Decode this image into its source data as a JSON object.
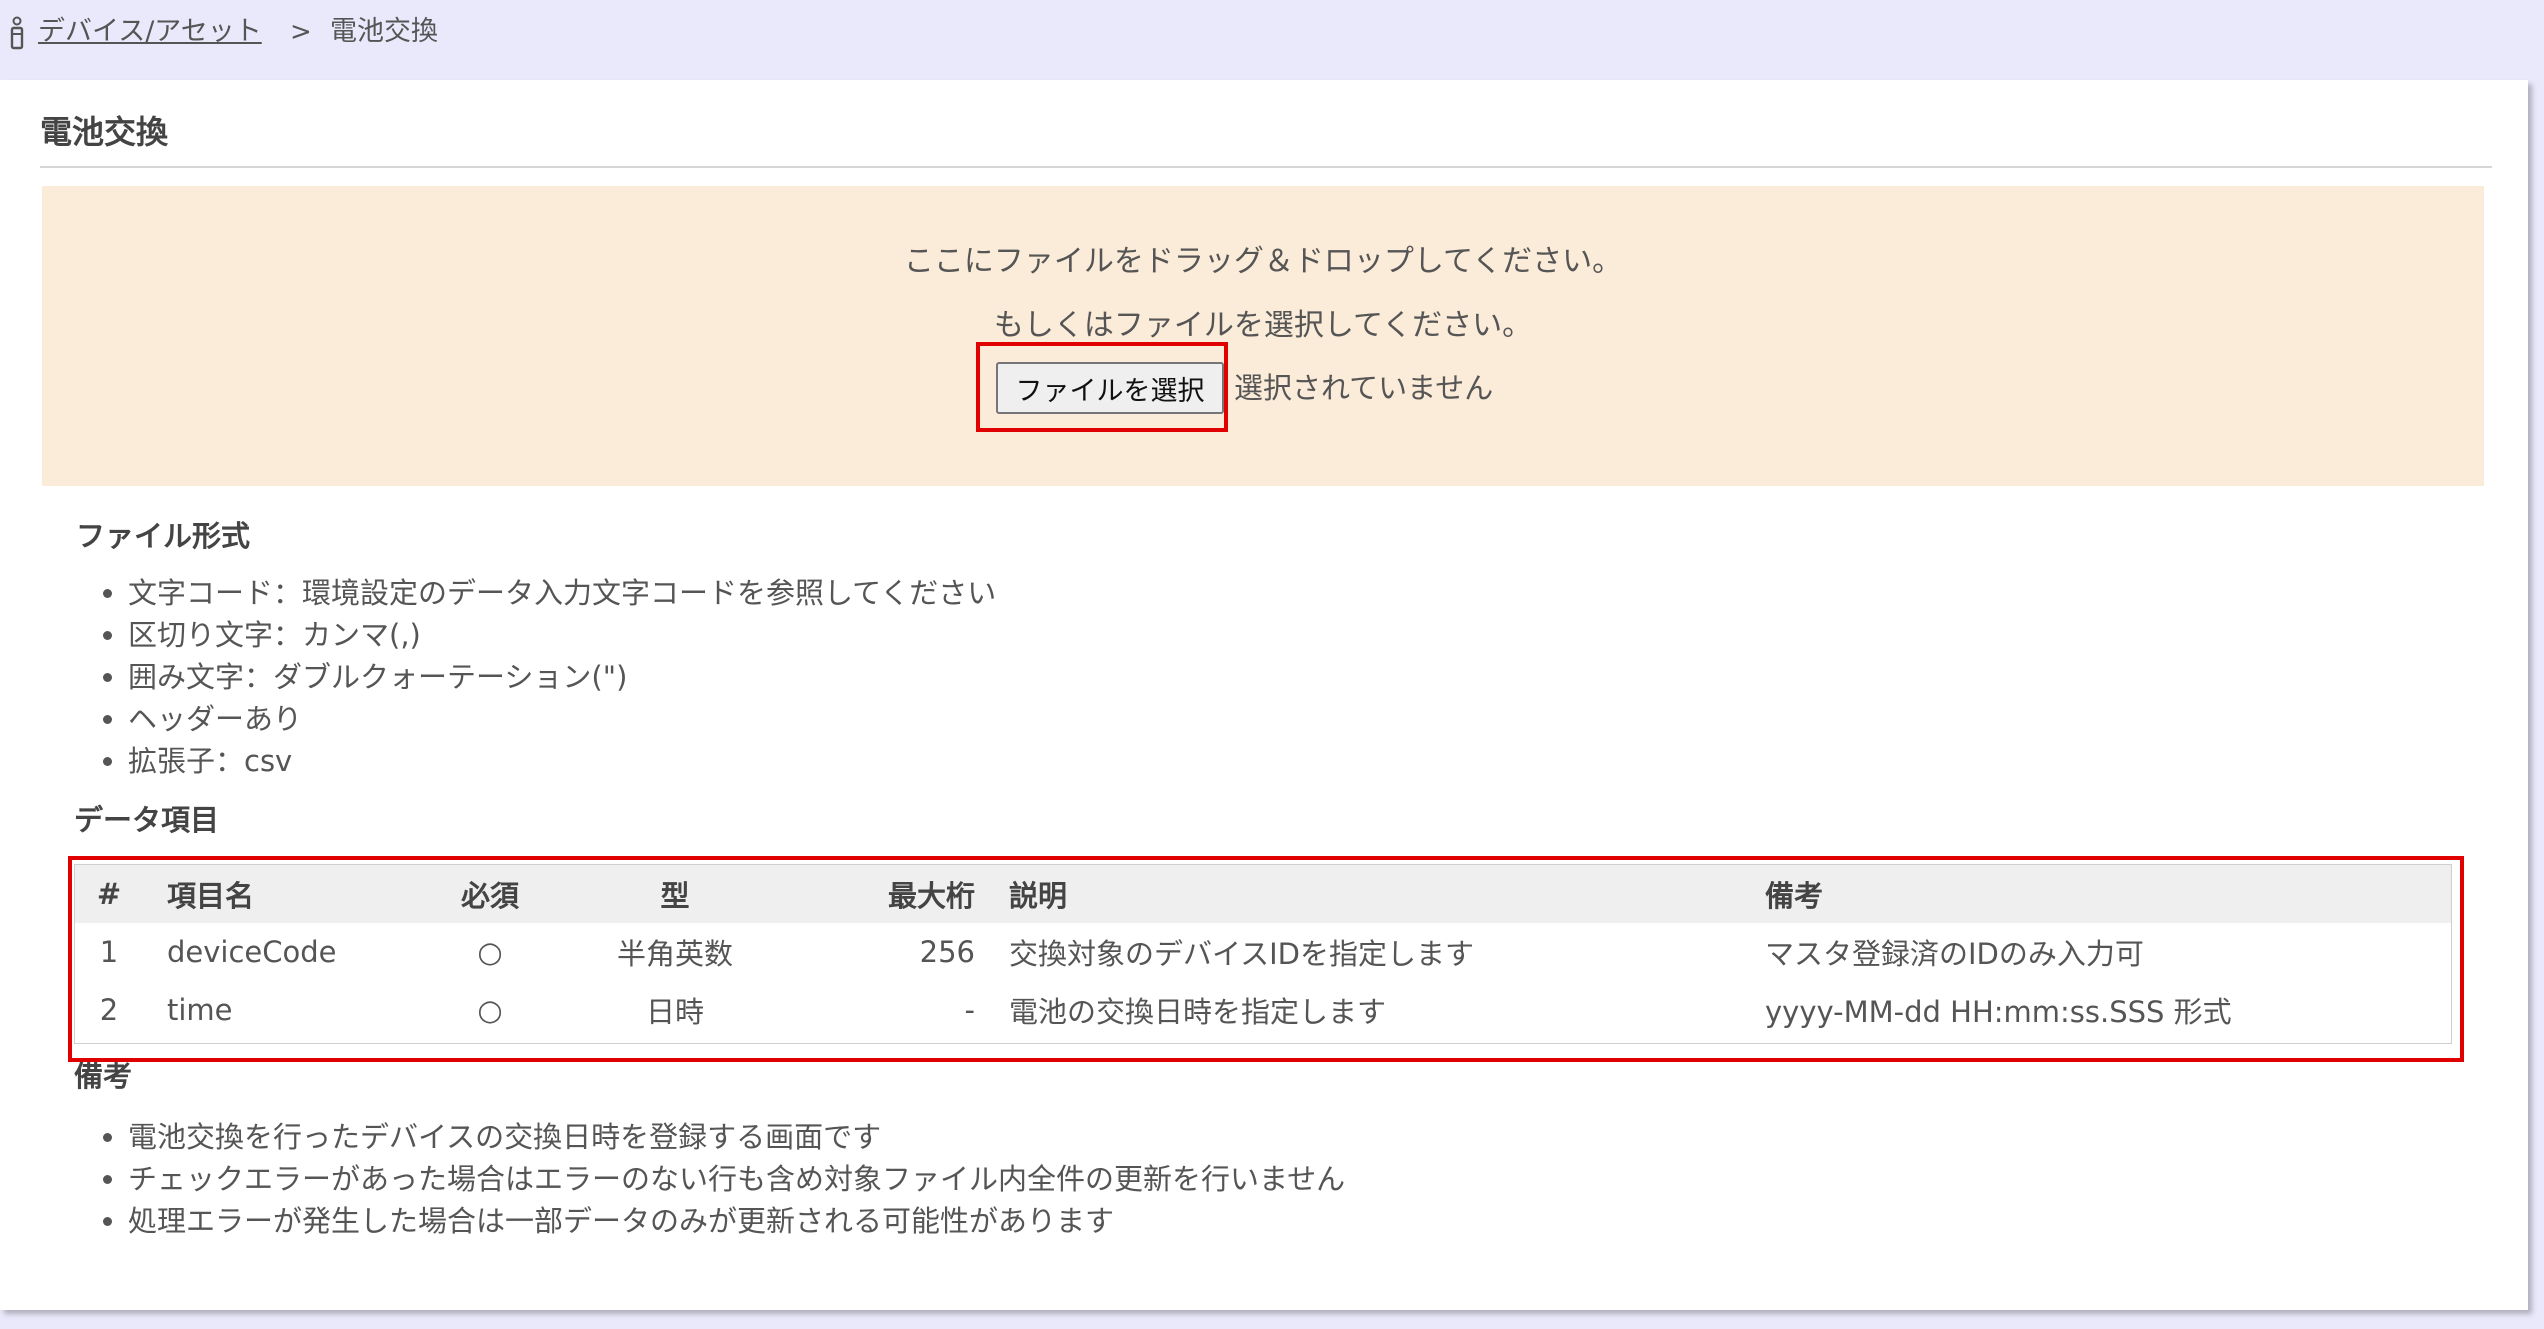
{
  "breadcrumb": {
    "parent_label": "デバイス/アセット",
    "separator": ">",
    "current_label": "電池交換"
  },
  "page": {
    "title": "電池交換"
  },
  "dropzone": {
    "line1": "ここにファイルをドラッグ＆ドロップしてください。",
    "line2": "もしくはファイルを選択してください。",
    "button_label": "ファイルを選択",
    "status_text": "選択されていません"
  },
  "file_format": {
    "heading": "ファイル形式",
    "items": [
      "文字コード：環境設定のデータ入力文字コードを参照してください",
      "区切り文字：カンマ(,)",
      "囲み文字：ダブルクォーテーション(\")",
      "ヘッダーあり",
      "拡張子：csv"
    ]
  },
  "data_items": {
    "heading": "データ項目",
    "columns": [
      "#",
      "項目名",
      "必須",
      "型",
      "最大桁",
      "説明",
      "備考"
    ],
    "rows": [
      [
        "1",
        "deviceCode",
        "○",
        "半角英数",
        "256",
        "交換対象のデバイスIDを指定します",
        "マスタ登録済のIDのみ入力可"
      ],
      [
        "2",
        "time",
        "○",
        "日時",
        "-",
        "電池の交換日時を指定します",
        "yyyy-MM-dd HH:mm:ss.SSS 形式"
      ]
    ]
  },
  "remarks": {
    "heading": "備考",
    "items": [
      "電池交換を行ったデバイスの交換日時を登録する画面です",
      "チェックエラーがあった場合はエラーのない行も含め対象ファイル内全件の更新を行いません",
      "処理エラーが発生した場合は一部データのみが更新される可能性があります"
    ]
  },
  "colors": {
    "header_bg": "#e9e9fb",
    "dropzone_bg": "#fbebd9",
    "highlight_border": "#e00000",
    "table_header_bg": "#efefef"
  },
  "icons": {
    "breadcrumb_icon": "device-icon"
  }
}
